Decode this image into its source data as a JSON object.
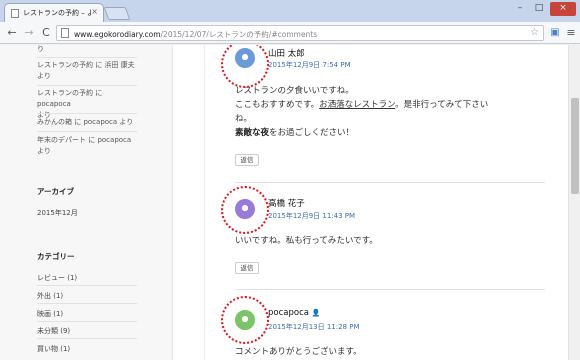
{
  "browser": {
    "tab_title": "レストランの予約 – よろず日記",
    "tab_close": "×",
    "url_host": "www.egokorodiary.com",
    "url_path": "/2015/12/07/レストランの予約/#comments",
    "min_glyph": "–",
    "max_glyph": "□",
    "close_glyph": "×",
    "back_glyph": "←",
    "forward_glyph": "→",
    "reload_glyph": "C",
    "star_glyph": "☆",
    "camera_glyph": "▣",
    "menu_glyph": "≡"
  },
  "sidebar": {
    "recent_comments": [
      {
        "lines": [
          "り"
        ]
      },
      {
        "lines": [
          "レストランの予約 に 浜田 康夫",
          "より"
        ]
      },
      {
        "lines": [
          "レストランの予約 に pocapoca",
          "より"
        ]
      },
      {
        "lines": [
          "みかんの箱 に pocapoca より"
        ]
      },
      {
        "lines": [
          "年末のデパート に pocapoca",
          "より"
        ]
      }
    ],
    "archive_heading": "アーカイブ",
    "archive_items": [
      "2015年12月"
    ],
    "category_heading": "カテゴリー",
    "category_items": [
      "レビュー (1)",
      "外出 (1)",
      "映画 (1)",
      "未分類 (9)",
      "買い物 (1)"
    ]
  },
  "comments": [
    {
      "author": "山田 太郎",
      "date": "2015年12月9日 7:54 PM",
      "avatar_color": "#6a9bd8",
      "lines": [
        "レストランの夕食いいですね。",
        "ここもおすすめです。お洒落なレストラン。是非行ってみて下さい",
        "ね。",
        "素敵な夜をお過ごしください！"
      ],
      "link_text": "お洒落なレストラン",
      "bold_text": "素敵な夜",
      "reply": "返信"
    },
    {
      "author": "高橋 花子",
      "date": "2015年12月9日 11:43 PM",
      "avatar_color": "#9a7ad8",
      "lines": [
        "いいですね。私も行ってみたいです。"
      ],
      "reply": "返信"
    },
    {
      "author": "pocapoca",
      "author_mark": "👤",
      "date": "2015年12月13日 11:28 PM",
      "avatar_color": "#7cc46a",
      "lines": [
        "コメントありがとうございます。"
      ],
      "reply": "返信"
    }
  ],
  "colors": {
    "highlight_circle": "#e0161c",
    "link_date": "#3a6db0",
    "close_button": "#c7443a"
  }
}
